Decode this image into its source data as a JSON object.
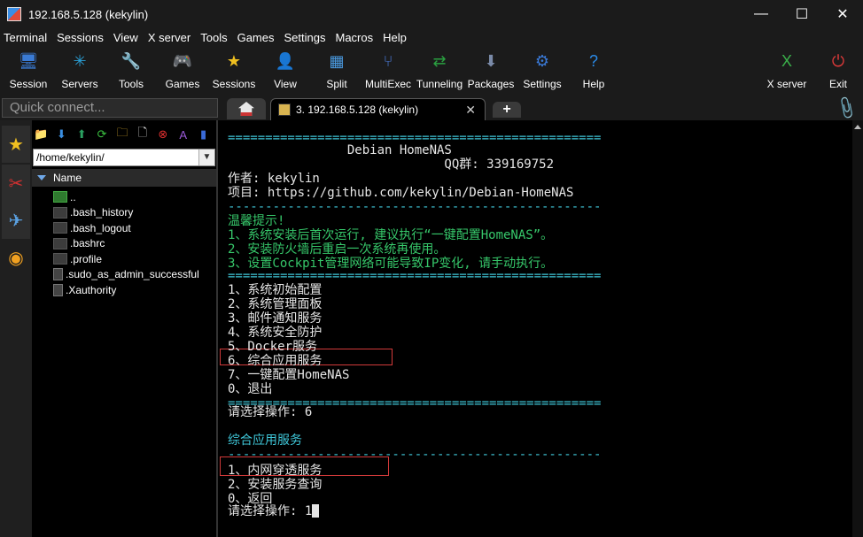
{
  "window": {
    "title": "192.168.5.128 (kekylin)",
    "minimize": "—",
    "maximize": "☐",
    "close": "✕"
  },
  "menu": [
    "Terminal",
    "Sessions",
    "View",
    "X server",
    "Tools",
    "Games",
    "Settings",
    "Macros",
    "Help"
  ],
  "toolbar": [
    {
      "label": "Session",
      "icon": "session-icon",
      "glyph": "🖥",
      "color": "#3a7bd5"
    },
    {
      "label": "Servers",
      "icon": "servers-icon",
      "glyph": "✳",
      "color": "#2a9fd6"
    },
    {
      "label": "Tools",
      "icon": "tools-icon",
      "glyph": "🔧",
      "color": "#d03030"
    },
    {
      "label": "Games",
      "icon": "games-icon",
      "glyph": "🎮",
      "color": "#888888"
    },
    {
      "label": "Sessions",
      "icon": "sessions-star-icon",
      "glyph": "★",
      "color": "#f0c020"
    },
    {
      "label": "View",
      "icon": "view-icon",
      "glyph": "👤",
      "color": "#5a8ad0"
    },
    {
      "label": "Split",
      "icon": "split-icon",
      "glyph": "▦",
      "color": "#4a9ae0"
    },
    {
      "label": "MultiExec",
      "icon": "multiexec-icon",
      "glyph": "⑂",
      "color": "#4a7ad8"
    },
    {
      "label": "Tunneling",
      "icon": "tunneling-icon",
      "glyph": "⇄",
      "color": "#2aa040"
    },
    {
      "label": "Packages",
      "icon": "packages-icon",
      "glyph": "⬇",
      "color": "#7a8aa8"
    },
    {
      "label": "Settings",
      "icon": "settings-icon",
      "glyph": "⚙",
      "color": "#3a7ad8"
    },
    {
      "label": "Help",
      "icon": "help-icon",
      "glyph": "?",
      "color": "#2a8ae8"
    },
    {
      "label": "X server",
      "icon": "xserver-icon",
      "glyph": "X",
      "color": "#3ab04a"
    },
    {
      "label": "Exit",
      "icon": "exit-icon",
      "glyph": "⏻",
      "color": "#e03a3a"
    }
  ],
  "quick_connect": {
    "placeholder": "Quick connect..."
  },
  "tabs": {
    "session_title": "3. 192.168.5.128 (kekylin)",
    "close": "✕",
    "new": "+"
  },
  "file_browser": {
    "path": "/home/kekylin/",
    "column_header": "Name",
    "files": [
      "..",
      ".bash_history",
      ".bash_logout",
      ".bashrc",
      ".profile",
      ".sudo_as_admin_successful",
      ".Xauthority"
    ]
  },
  "terminal": {
    "lines": [
      {
        "text": "==================================================",
        "color": "cy"
      },
      {
        "text": "                Debian HomeNAS",
        "color": "wh"
      },
      {
        "text": "                             QQ群: 339169752",
        "color": "wh"
      },
      {
        "text": "作者: kekylin",
        "color": "wh"
      },
      {
        "text": "项目: https://github.com/kekylin/Debian-HomeNAS",
        "color": "wh"
      },
      {
        "text": "--------------------------------------------------",
        "color": "cy"
      },
      {
        "text": "温馨提示!",
        "color": "gr"
      },
      {
        "text": "1、系统安装后首次运行, 建议执行“一键配置HomeNAS”。",
        "color": "gr"
      },
      {
        "text": "2、安装防火墙后重启一次系统再使用。",
        "color": "gr"
      },
      {
        "text": "3、设置Cockpit管理网络可能导致IP变化, 请手动执行。",
        "color": "gr"
      },
      {
        "text": "==================================================",
        "color": "cy"
      },
      {
        "text": "1、系统初始配置",
        "color": "wh"
      },
      {
        "text": "2、系统管理面板",
        "color": "wh"
      },
      {
        "text": "3、邮件通知服务",
        "color": "wh"
      },
      {
        "text": "4、系统安全防护",
        "color": "wh"
      },
      {
        "text": "5、Docker服务",
        "color": "wh"
      },
      {
        "text": "6、综合应用服务",
        "color": "wh"
      },
      {
        "text": "7、一键配置HomeNAS",
        "color": "wh"
      },
      {
        "text": "0、退出",
        "color": "wh"
      },
      {
        "text": "==================================================",
        "color": "cy"
      },
      {
        "text": "请选择操作: 6",
        "color": "wh"
      },
      {
        "text": "",
        "color": "wh"
      },
      {
        "text": "综合应用服务",
        "color": "cy"
      },
      {
        "text": "--------------------------------------------------",
        "color": "cy"
      },
      {
        "text": "1、内网穿透服务",
        "color": "wh"
      },
      {
        "text": "2、安装服务查询",
        "color": "wh"
      },
      {
        "text": "0、返回",
        "color": "wh"
      },
      {
        "text": "请选择操作: 1",
        "color": "wh"
      }
    ]
  }
}
